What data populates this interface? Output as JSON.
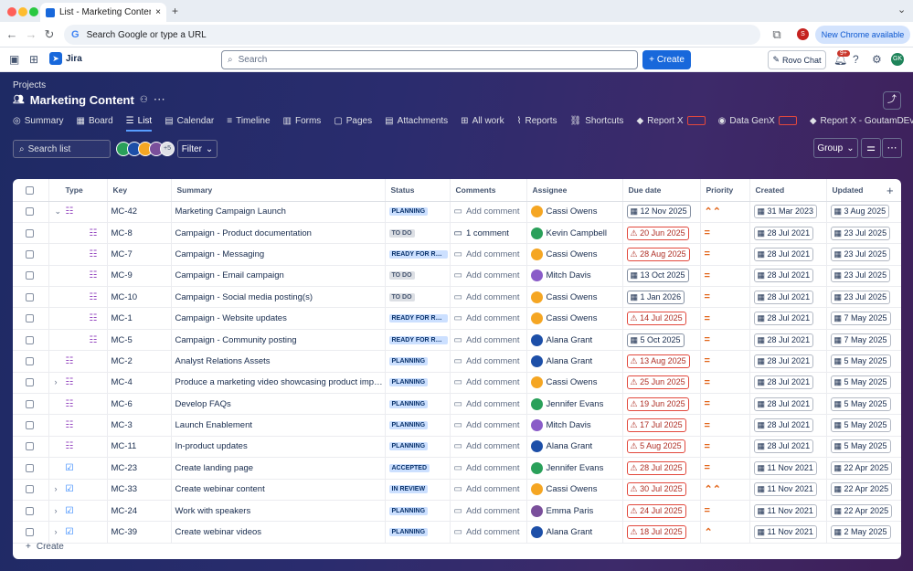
{
  "browser": {
    "tab_title": "List - Marketing Content - Jira",
    "new_tab": "+",
    "address_placeholder": "Search Google or type a URL",
    "new_chrome": "New Chrome available",
    "profile_initial": "S",
    "menu_chevron": "⌄"
  },
  "jira": {
    "product": "Jira",
    "search_placeholder": "Search",
    "create": "Create",
    "rovo": "Rovo Chat",
    "notif_badge": "9+",
    "user_initials": "GK"
  },
  "project": {
    "breadcrumb": "Projects",
    "title": "Marketing Content",
    "tabs": [
      {
        "label": "Summary",
        "icon": "◎"
      },
      {
        "label": "Board",
        "icon": "▦"
      },
      {
        "label": "List",
        "icon": "☰"
      },
      {
        "label": "Calendar",
        "icon": "▤"
      },
      {
        "label": "Timeline",
        "icon": "≡"
      },
      {
        "label": "Forms",
        "icon": "▥"
      },
      {
        "label": "Pages",
        "icon": "▢"
      },
      {
        "label": "Attachments",
        "icon": "▤"
      },
      {
        "label": "All work",
        "icon": "⊞"
      },
      {
        "label": "Reports",
        "icon": "⌇"
      },
      {
        "label": "Shortcuts",
        "icon": "⛓"
      },
      {
        "label": "Report X",
        "icon": "◆"
      },
      {
        "label": "Data GenX",
        "icon": "◉"
      },
      {
        "label": "Report X - GoutamDEv",
        "icon": "◆"
      }
    ]
  },
  "toolbar": {
    "search_placeholder": "Search list",
    "filter": "Filter",
    "group": "Group",
    "more_avatars": "+5"
  },
  "table": {
    "headers": [
      "Type",
      "Key",
      "Summary",
      "Status",
      "Comments",
      "Assignee",
      "Due date",
      "Priority",
      "Created",
      "Updated"
    ],
    "rows": [
      {
        "key": "MC-42",
        "summary": "Marketing Campaign Launch",
        "status": "PLANNING",
        "st": "planning",
        "comment": "Add comment",
        "assignee": "Cassi Owens",
        "ac": "#f5a623",
        "due": "12 Nov 2025",
        "over": false,
        "prio": "⌃⌃",
        "created": "31 Mar 2023",
        "updated": "3 Aug 2025",
        "type": "epic",
        "chev": "⌄",
        "indent": 0
      },
      {
        "key": "MC-8",
        "summary": "Campaign - Product documentation",
        "status": "TO DO",
        "st": "todo",
        "comment": "1 comment",
        "assignee": "Kevin Campbell",
        "ac": "#2aa05a",
        "due": "20 Jun 2025",
        "over": true,
        "prio": "=",
        "created": "28 Jul 2021",
        "updated": "23 Jul 2025",
        "type": "epic",
        "chev": "",
        "indent": 1
      },
      {
        "key": "MC-7",
        "summary": "Campaign - Messaging",
        "status": "READY FOR REVIEW",
        "st": "ready",
        "comment": "Add comment",
        "assignee": "Cassi Owens",
        "ac": "#f5a623",
        "due": "28 Aug 2025",
        "over": true,
        "prio": "=",
        "created": "28 Jul 2021",
        "updated": "23 Jul 2025",
        "type": "epic",
        "chev": "",
        "indent": 1
      },
      {
        "key": "MC-9",
        "summary": "Campaign - Email campaign",
        "status": "TO DO",
        "st": "todo",
        "comment": "Add comment",
        "assignee": "Mitch Davis",
        "ac": "#8a5cc8",
        "due": "13 Oct 2025",
        "over": false,
        "prio": "=",
        "created": "28 Jul 2021",
        "updated": "23 Jul 2025",
        "type": "epic",
        "chev": "",
        "indent": 1
      },
      {
        "key": "MC-10",
        "summary": "Campaign - Social media posting(s)",
        "status": "TO DO",
        "st": "todo",
        "comment": "Add comment",
        "assignee": "Cassi Owens",
        "ac": "#f5a623",
        "due": "1 Jan 2026",
        "over": false,
        "prio": "=",
        "created": "28 Jul 2021",
        "updated": "23 Jul 2025",
        "type": "epic",
        "chev": "",
        "indent": 1
      },
      {
        "key": "MC-1",
        "summary": "Campaign - Website updates",
        "status": "READY FOR REVIEW",
        "st": "ready",
        "comment": "Add comment",
        "assignee": "Cassi Owens",
        "ac": "#f5a623",
        "due": "14 Jul 2025",
        "over": true,
        "prio": "=",
        "created": "28 Jul 2021",
        "updated": "7 May 2025",
        "type": "epic",
        "chev": "",
        "indent": 1
      },
      {
        "key": "MC-5",
        "summary": "Campaign - Community posting",
        "status": "READY FOR REVIEW",
        "st": "ready",
        "comment": "Add comment",
        "assignee": "Alana Grant",
        "ac": "#1d4fa8",
        "due": "5 Oct 2025",
        "over": false,
        "prio": "=",
        "created": "28 Jul 2021",
        "updated": "7 May 2025",
        "type": "epic",
        "chev": "",
        "indent": 1
      },
      {
        "key": "MC-2",
        "summary": "Analyst Relations Assets",
        "status": "PLANNING",
        "st": "planning",
        "comment": "Add comment",
        "assignee": "Alana Grant",
        "ac": "#1d4fa8",
        "due": "13 Aug 2025",
        "over": true,
        "prio": "=",
        "created": "28 Jul 2021",
        "updated": "5 May 2025",
        "type": "epic",
        "chev": "",
        "indent": 0
      },
      {
        "key": "MC-4",
        "summary": "Produce a marketing video showcasing product improvements",
        "status": "PLANNING",
        "st": "planning",
        "comment": "Add comment",
        "assignee": "Cassi Owens",
        "ac": "#f5a623",
        "due": "25 Jun 2025",
        "over": true,
        "prio": "=",
        "created": "28 Jul 2021",
        "updated": "5 May 2025",
        "type": "epic",
        "chev": "›",
        "indent": 0
      },
      {
        "key": "MC-6",
        "summary": "Develop FAQs",
        "status": "PLANNING",
        "st": "planning",
        "comment": "Add comment",
        "assignee": "Jennifer Evans",
        "ac": "#2aa05a",
        "due": "19 Jun 2025",
        "over": true,
        "prio": "=",
        "created": "28 Jul 2021",
        "updated": "5 May 2025",
        "type": "epic",
        "chev": "",
        "indent": 0
      },
      {
        "key": "MC-3",
        "summary": "Launch Enablement",
        "status": "PLANNING",
        "st": "planning",
        "comment": "Add comment",
        "assignee": "Mitch Davis",
        "ac": "#8a5cc8",
        "due": "17 Jul 2025",
        "over": true,
        "prio": "=",
        "created": "28 Jul 2021",
        "updated": "5 May 2025",
        "type": "epic",
        "chev": "",
        "indent": 0
      },
      {
        "key": "MC-11",
        "summary": "In-product updates",
        "status": "PLANNING",
        "st": "planning",
        "comment": "Add comment",
        "assignee": "Alana Grant",
        "ac": "#1d4fa8",
        "due": "5 Aug 2025",
        "over": true,
        "prio": "=",
        "created": "28 Jul 2021",
        "updated": "5 May 2025",
        "type": "epic",
        "chev": "",
        "indent": 0
      },
      {
        "key": "MC-23",
        "summary": "Create landing page",
        "status": "ACCEPTED",
        "st": "accepted",
        "comment": "Add comment",
        "assignee": "Jennifer Evans",
        "ac": "#2aa05a",
        "due": "28 Jul 2025",
        "over": true,
        "prio": "=",
        "created": "11 Nov 2021",
        "updated": "22 Apr 2025",
        "type": "task",
        "chev": "",
        "indent": 0
      },
      {
        "key": "MC-33",
        "summary": "Create webinar content",
        "status": "IN REVIEW",
        "st": "review",
        "comment": "Add comment",
        "assignee": "Cassi Owens",
        "ac": "#f5a623",
        "due": "30 Jul 2025",
        "over": true,
        "prio": "⌃⌃",
        "created": "11 Nov 2021",
        "updated": "22 Apr 2025",
        "type": "task",
        "chev": "›",
        "indent": 0
      },
      {
        "key": "MC-24",
        "summary": "Work with speakers",
        "status": "PLANNING",
        "st": "planning",
        "comment": "Add comment",
        "assignee": "Emma Paris",
        "ac": "#7a4f9b",
        "due": "24 Jul 2025",
        "over": true,
        "prio": "=",
        "created": "11 Nov 2021",
        "updated": "22 Apr 2025",
        "type": "task",
        "chev": "›",
        "indent": 0
      },
      {
        "key": "MC-39",
        "summary": "Create webinar videos",
        "status": "PLANNING",
        "st": "planning",
        "comment": "Add comment",
        "assignee": "Alana Grant",
        "ac": "#1d4fa8",
        "due": "18 Jul 2025",
        "over": true,
        "prio": "⌃",
        "created": "11 Nov 2021",
        "updated": "2 May 2025",
        "type": "task",
        "chev": "›",
        "indent": 0
      }
    ],
    "create": "Create"
  },
  "colors": {
    "accent": "#1868db",
    "overdue": "#e2483d"
  }
}
